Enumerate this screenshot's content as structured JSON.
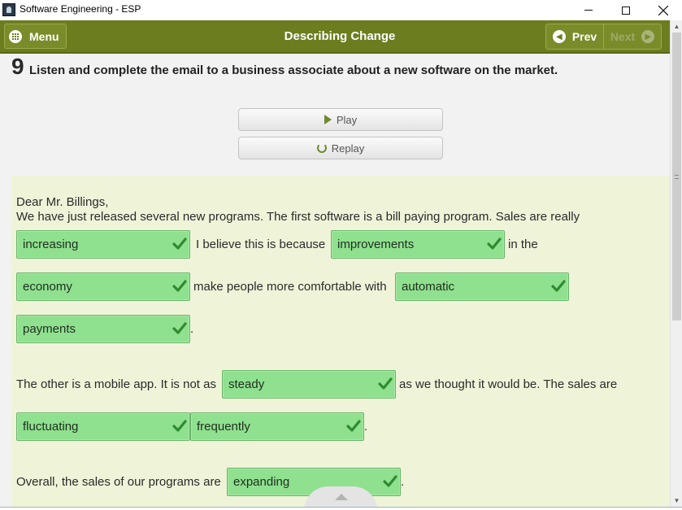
{
  "window": {
    "title": "Software Engineering - ESP"
  },
  "header": {
    "menu_label": "Menu",
    "title": "Describing Change",
    "prev_label": "Prev",
    "next_label": "Next"
  },
  "exercise": {
    "number": "9",
    "instruction": "Listen and complete the email to a business associate about a new software on the market."
  },
  "audio": {
    "play_label": "Play",
    "replay_label": "Replay"
  },
  "email": {
    "salutation": "Dear Mr. Billings,",
    "p1_line1": "We have just released several new programs. The first software is a bill paying program. Sales are really",
    "p1_text_a": "I believe this is because",
    "p1_text_b": "in the",
    "p1_text_c": "make people more comfortable with",
    "p1_end": ".",
    "p2_text_a": "The other is a mobile app. It is not as",
    "p2_text_b": "as we thought it would be. The sales are",
    "p2_end": ".",
    "p3_text_a": "Overall, the sales of our programs are",
    "p3_end": "."
  },
  "answers": [
    {
      "id": "a1",
      "value": "increasing",
      "status": "correct"
    },
    {
      "id": "a2",
      "value": "improvements",
      "status": "correct"
    },
    {
      "id": "a3",
      "value": "economy",
      "status": "correct"
    },
    {
      "id": "a4",
      "value": "automatic",
      "status": "correct"
    },
    {
      "id": "a5",
      "value": "payments",
      "status": "correct"
    },
    {
      "id": "a6",
      "value": "steady",
      "status": "correct"
    },
    {
      "id": "a7",
      "value": "fluctuating",
      "status": "correct"
    },
    {
      "id": "a8",
      "value": "frequently",
      "status": "correct"
    },
    {
      "id": "a9",
      "value": "expanding",
      "status": "correct"
    }
  ],
  "colors": {
    "header_green": "#6b7d1e",
    "answer_green": "#8fe08f",
    "check_green": "#2e8b2e",
    "email_bg": "#eff4d9"
  },
  "icons": {
    "menu": "grid-icon",
    "prev": "chevron-left-icon",
    "next": "chevron-right-icon",
    "play": "play-icon",
    "replay": "replay-icon",
    "answer_status": "checkmark-icon"
  }
}
